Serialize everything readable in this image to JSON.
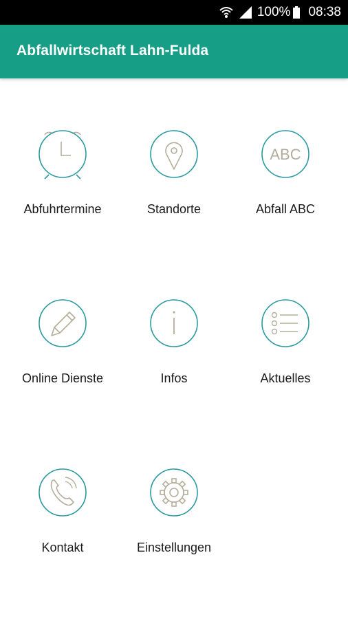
{
  "status_bar": {
    "battery": "100%",
    "time": "08:38",
    "icons": [
      "wifi-icon",
      "signal-icon",
      "battery-icon"
    ]
  },
  "app_bar": {
    "title": "Abfallwirtschaft Lahn-Fulda",
    "color": "#169e87"
  },
  "menu": [
    {
      "label": "Abfuhrtermine",
      "icon": "alarm-clock-icon"
    },
    {
      "label": "Standorte",
      "icon": "location-pin-icon"
    },
    {
      "label": "Abfall ABC",
      "icon": "abc-icon",
      "icon_text": "ABC"
    },
    {
      "label": "Online Dienste",
      "icon": "pencil-icon"
    },
    {
      "label": "Infos",
      "icon": "info-icon"
    },
    {
      "label": "Aktuelles",
      "icon": "list-icon"
    },
    {
      "label": "Kontakt",
      "icon": "phone-icon"
    },
    {
      "label": "Einstellungen",
      "icon": "gear-icon"
    }
  ],
  "colors": {
    "icon_circle": "#2a9aa0",
    "icon_glyph": "#b5ad9b"
  }
}
